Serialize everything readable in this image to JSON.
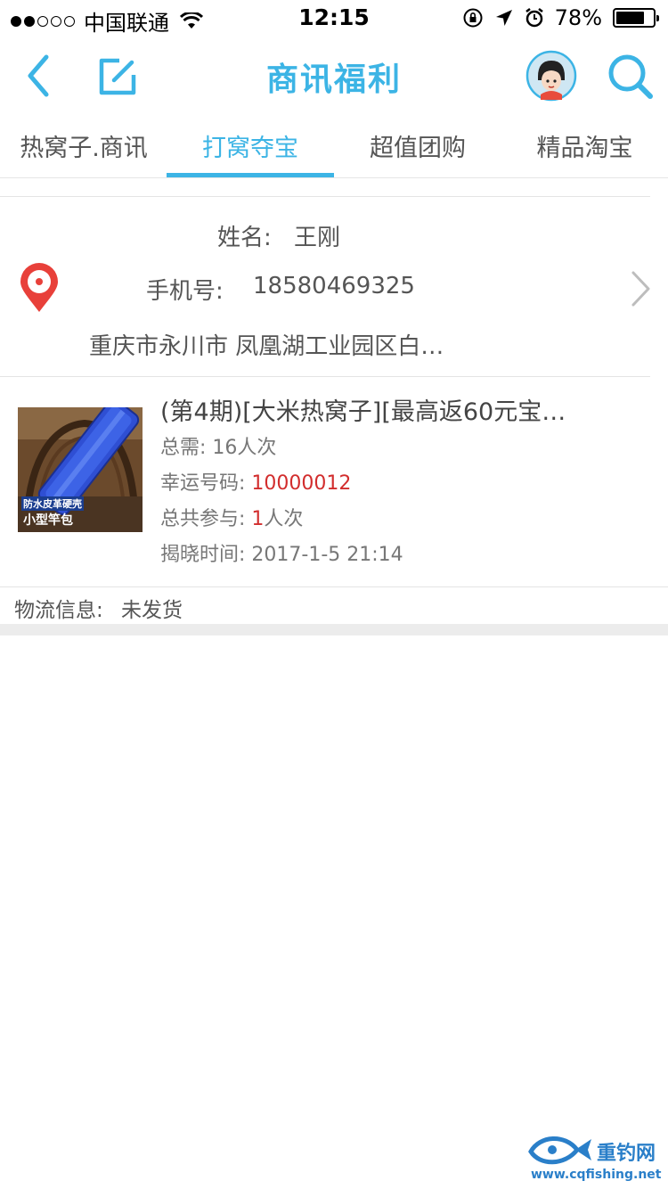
{
  "status_bar": {
    "carrier": "中国联通",
    "time": "12:15",
    "battery_percent": "78%",
    "battery_level": 0.78,
    "signal_bars": 2
  },
  "nav": {
    "title": "商讯福利",
    "back_icon": "chevron-left-icon",
    "edit_icon": "edit-icon",
    "avatar_icon": "avatar-icon",
    "search_icon": "search-icon"
  },
  "tabs": [
    {
      "label": "热窝子.商讯",
      "active": false
    },
    {
      "label": "打窝夺宝",
      "active": true
    },
    {
      "label": "超值团购",
      "active": false
    },
    {
      "label": "精品淘宝",
      "active": false
    }
  ],
  "address": {
    "name_label": "姓名:",
    "name": "王刚",
    "phone_label": "手机号:",
    "phone": "18580469325",
    "address": "重庆市永川市 凤凰湖工业园区白…"
  },
  "order": {
    "title": "(第4期)[大米热窝子][最高返60元宝…",
    "total_label": "总需:",
    "total_value": "16人次",
    "lucky_label": "幸运号码:",
    "lucky_number": "10000012",
    "joined_label": "总共参与:",
    "joined_count": "1",
    "joined_unit": "人次",
    "reveal_label": "揭晓时间:",
    "reveal_time": "2017-1-5 21:14",
    "thumb_text_1": "防水皮革硬壳",
    "thumb_text_2": "小型竿包"
  },
  "logistics": {
    "label": "物流信息:",
    "value": "未发货"
  },
  "watermark": {
    "name": "重钓网",
    "url": "www.cqfishing.net"
  },
  "colors": {
    "accent": "#3cb4e5",
    "red": "#d22d2d",
    "location_red": "#e8403a"
  }
}
